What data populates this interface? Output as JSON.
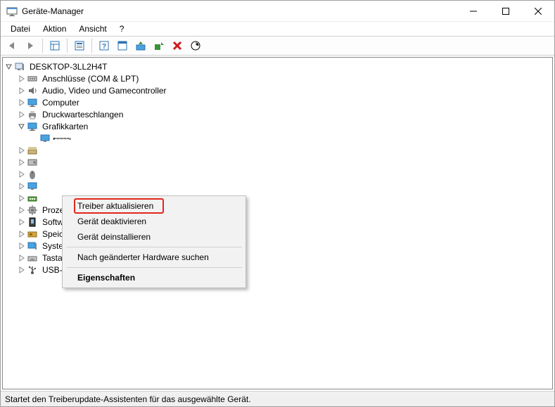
{
  "window": {
    "title": "Geräte-Manager"
  },
  "menubar": {
    "file": "Datei",
    "action": "Aktion",
    "view": "Ansicht",
    "help": "?"
  },
  "tree": {
    "root": "DESKTOP-3LL2H4T",
    "items": [
      {
        "label": "Anschlüsse (COM & LPT)",
        "icon": "port-icon"
      },
      {
        "label": "Audio, Video und Gamecontroller",
        "icon": "audio-icon"
      },
      {
        "label": "Computer",
        "icon": "computer-icon"
      },
      {
        "label": "Druckwarteschlangen",
        "icon": "printer-icon"
      },
      {
        "label": "Grafikkarten",
        "icon": "display-icon",
        "expanded": true,
        "child": ""
      },
      {
        "label": "",
        "icon": "hid-icon"
      },
      {
        "label": "",
        "icon": "hdd-icon"
      },
      {
        "label": "",
        "icon": "mouse-icon"
      },
      {
        "label": "",
        "icon": "monitor-icon"
      },
      {
        "label": "",
        "icon": "network-icon"
      },
      {
        "label": "Prozessoren",
        "icon": "cpu-icon"
      },
      {
        "label": "Softwaregeräte",
        "icon": "software-icon"
      },
      {
        "label": "Speichercontroller",
        "icon": "storagectl-icon"
      },
      {
        "label": "Systemgeräte",
        "icon": "system-icon"
      },
      {
        "label": "Tastaturen",
        "icon": "keyboard-icon"
      },
      {
        "label": "USB-Controller",
        "icon": "usb-icon"
      }
    ]
  },
  "contextmenu": {
    "update_driver": "Treiber aktualisieren",
    "disable": "Gerät deaktivieren",
    "uninstall": "Gerät deinstallieren",
    "scan": "Nach geänderter Hardware suchen",
    "properties": "Eigenschaften"
  },
  "statusbar": {
    "text": "Startet den Treiberupdate-Assistenten für das ausgewählte Gerät."
  }
}
